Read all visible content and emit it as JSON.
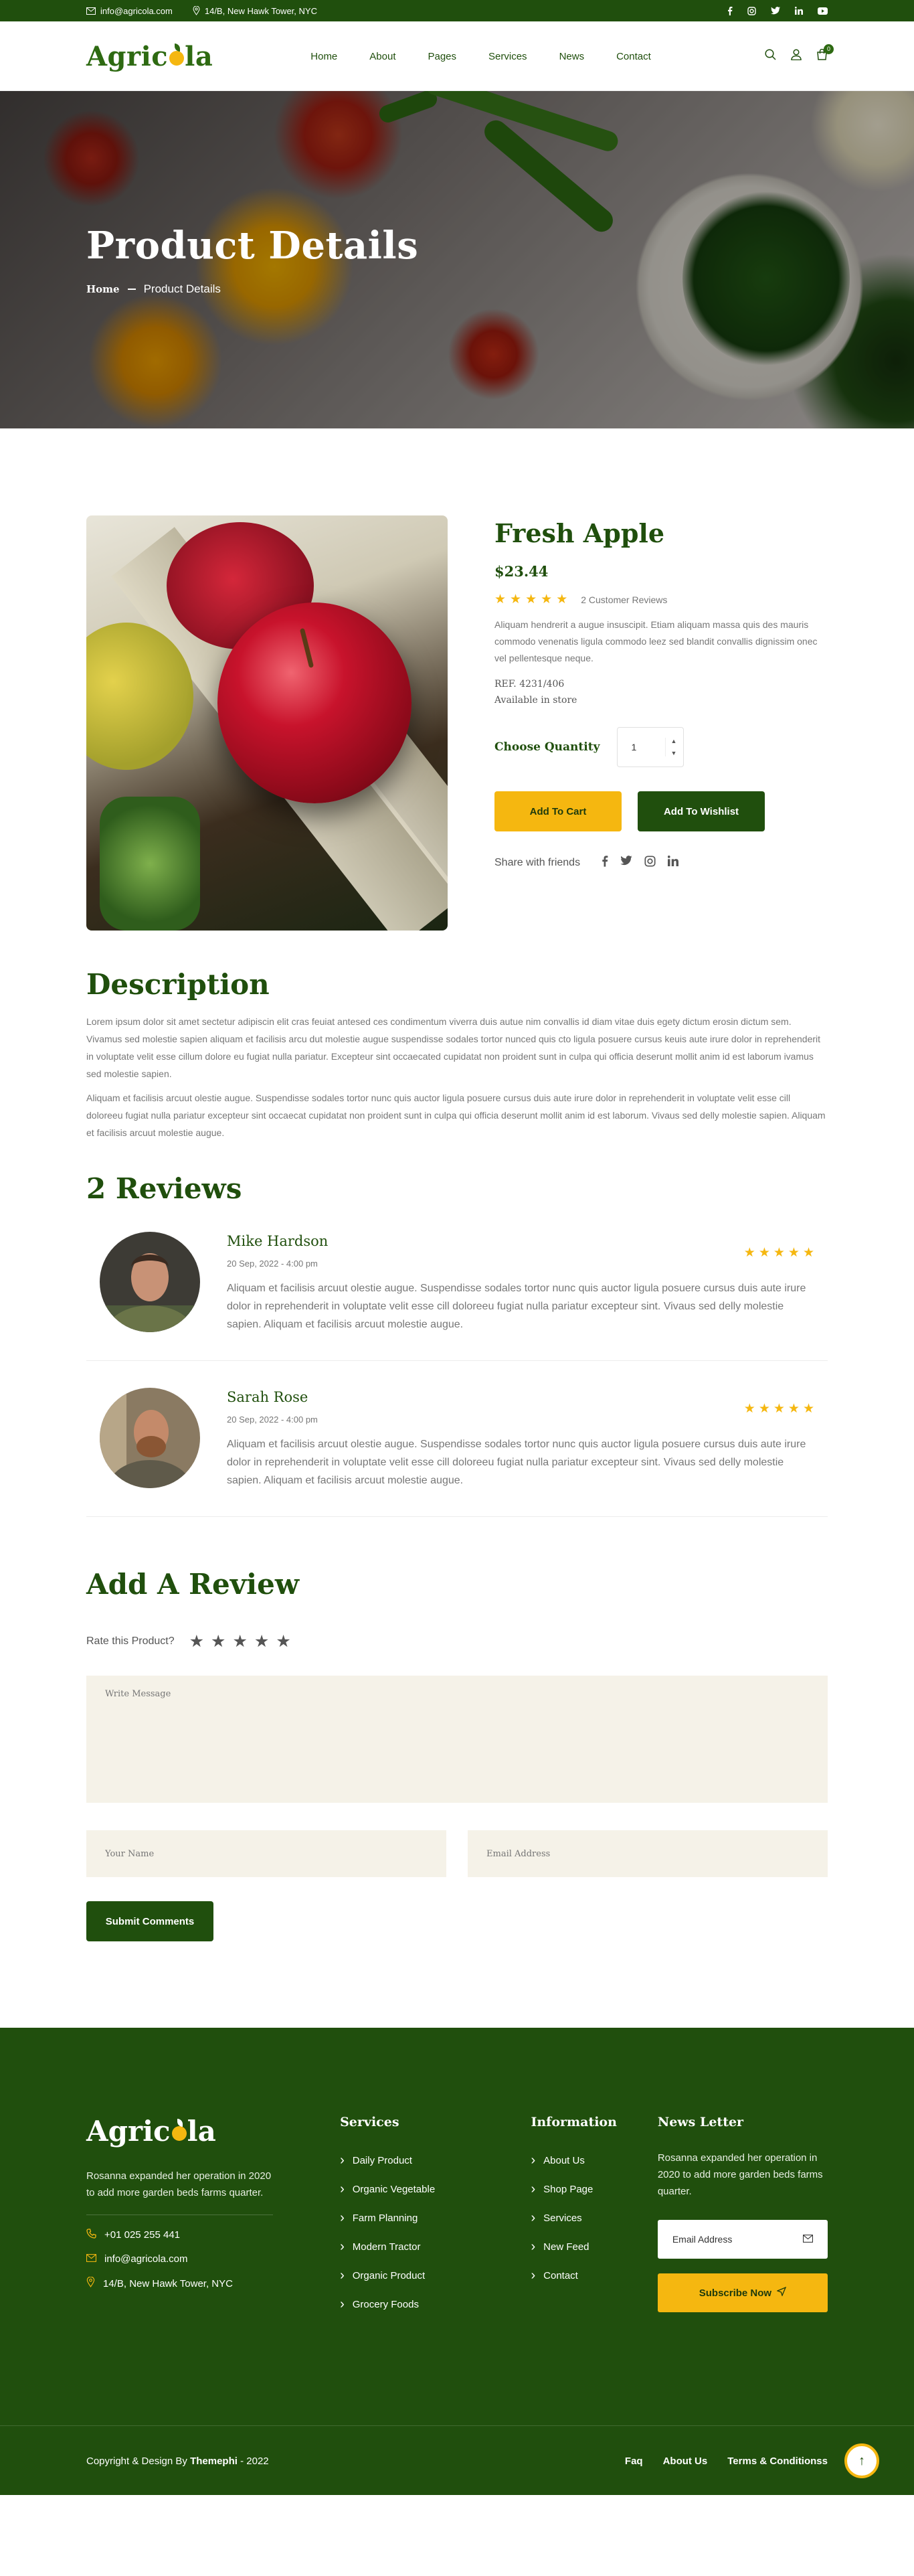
{
  "topbar": {
    "email": "info@agricola.com",
    "address": "14/B, New Hawk Tower, NYC"
  },
  "brand": {
    "name_prefix": "Agric",
    "name_suffix": "la"
  },
  "nav": [
    "Home",
    "About",
    "Pages",
    "Services",
    "News",
    "Contact"
  ],
  "cart": {
    "count": "0"
  },
  "hero": {
    "title": "Product Details",
    "crumb_home": "Home",
    "crumb_current": "Product Details"
  },
  "product": {
    "name": "Fresh Apple",
    "price": "$23.44",
    "rating": 5,
    "reviews_count": "2 Customer Reviews",
    "description": "Aliquam hendrerit a augue insuscipit. Etiam aliquam massa quis des mauris commodo venenatis ligula commodo leez sed blandit convallis dignissim onec vel pellentesque neque.",
    "ref": "REF. 4231/406",
    "availability": "Available in store",
    "quantity_label": "Choose Quantity",
    "quantity": "1",
    "add_to_cart": "Add To Cart",
    "add_to_wishlist": "Add To Wishlist",
    "share_label": "Share with friends"
  },
  "description": {
    "title": "Description",
    "p1": "Lorem ipsum dolor sit amet sectetur adipiscin elit cras feuiat antesed ces condimentum viverra duis autue nim convallis id diam vitae duis egety dictum erosin dictum sem. Vivamus sed molestie sapien aliquam et facilisis arcu dut molestie augue suspendisse sodales tortor nunced quis cto ligula posuere cursus keuis aute irure dolor in reprehenderit in voluptate velit esse cillum dolore eu fugiat nulla pariatur. Excepteur sint occaecated cupidatat non proident sunt in culpa qui officia deserunt mollit anim id est laborum ivamus sed molestie sapien.",
    "p2": "Aliquam et facilisis arcuut olestie augue. Suspendisse sodales tortor nunc quis auctor ligula posuere cursus duis aute irure dolor in reprehenderit in voluptate velit esse cill doloreeu fugiat nulla pariatur excepteur sint occaecat cupidatat non proident sunt in culpa qui officia deserunt mollit anim id est laborum. Vivaus sed delly molestie sapien. Aliquam et facilisis arcuut molestie augue."
  },
  "reviews": {
    "title": "2 Reviews",
    "items": [
      {
        "name": "Mike Hardson",
        "date": "20 Sep, 2022 - 4:00 pm",
        "rating": 5,
        "text": "Aliquam et facilisis arcuut olestie augue. Suspendisse sodales tortor nunc quis auctor ligula posuere cursus duis aute irure dolor in reprehenderit in voluptate velit esse cill doloreeu fugiat nulla pariatur excepteur sint. Vivaus sed delly molestie sapien. Aliquam et facilisis arcuut molestie augue."
      },
      {
        "name": "Sarah Rose",
        "date": "20 Sep, 2022 - 4:00 pm",
        "rating": 5,
        "text": "Aliquam et facilisis arcuut olestie augue. Suspendisse sodales tortor nunc quis auctor ligula posuere cursus duis aute irure dolor in reprehenderit in voluptate velit esse cill doloreeu fugiat nulla pariatur excepteur sint. Vivaus sed delly molestie sapien. Aliquam et facilisis arcuut molestie augue."
      }
    ]
  },
  "add_review": {
    "title": "Add A Review",
    "rate_label": "Rate this Product?",
    "message_placeholder": "Write Message",
    "name_placeholder": "Your Name",
    "email_placeholder": "Email Address",
    "submit": "Submit Comments"
  },
  "footer": {
    "about": "Rosanna expanded her operation in 2020 to add more garden beds farms quarter.",
    "phone": "+01 025 255 441",
    "email": "info@agricola.com",
    "address": "14/B, New Hawk Tower, NYC",
    "services_title": "Services",
    "services": [
      "Daily Product",
      "Organic Vegetable",
      "Farm Planning",
      "Modern Tractor",
      "Organic Product",
      "Grocery Foods"
    ],
    "info_title": "Information",
    "info": [
      "About Us",
      "Shop Page",
      "Services",
      "New Feed",
      "Contact"
    ],
    "newsletter_title": "News Letter",
    "newsletter_text": "Rosanna expanded her operation in 2020 to add more garden beds farms quarter.",
    "newsletter_placeholder": "Email Address",
    "subscribe": "Subscribe Now",
    "copyright": "Copyright & Design By",
    "copyright_brand": "Themephi",
    "copyright_year": "- 2022",
    "bottom_links": [
      "Faq",
      "About Us",
      "Terms & Conditionss"
    ]
  },
  "colors": {
    "brand_green": "#204f0d",
    "accent_yellow": "#f5b710",
    "cream": "#f5f2e8"
  },
  "icons": [
    "mail-icon",
    "location-icon",
    "facebook-icon",
    "instagram-icon",
    "twitter-icon",
    "linkedin-icon",
    "youtube-icon",
    "search-icon",
    "user-icon",
    "cart-icon",
    "phone-icon",
    "send-icon",
    "arrow-up-icon"
  ]
}
